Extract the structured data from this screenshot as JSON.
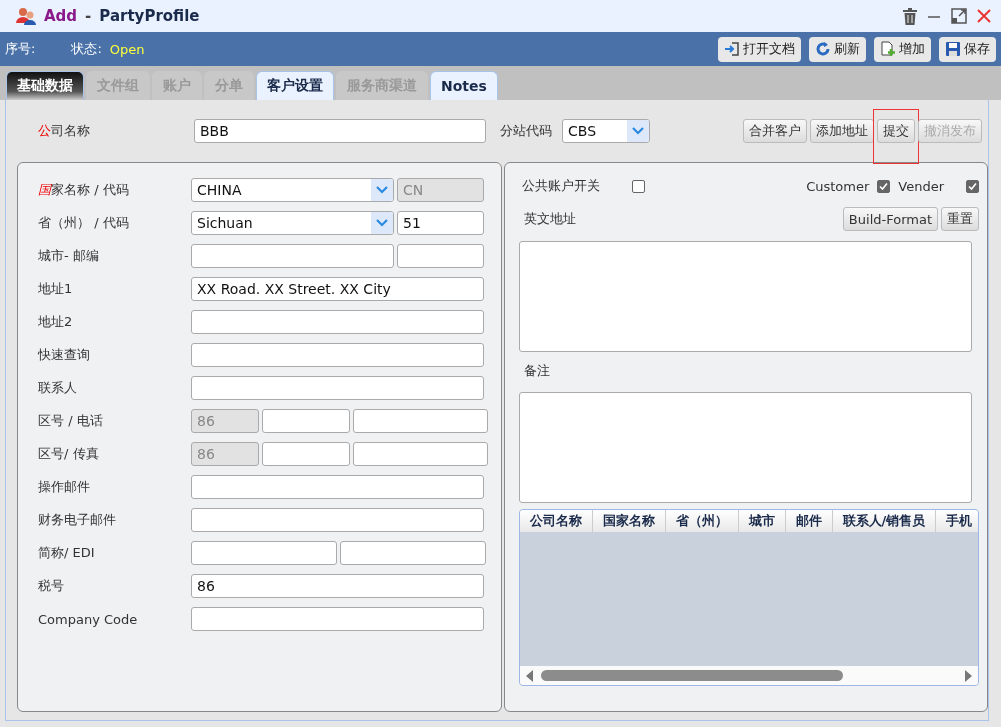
{
  "window": {
    "title_action": "Add",
    "title_separator": "-",
    "title": "PartyProfile"
  },
  "status": {
    "seq_label": "序号:",
    "state_label": "状态:",
    "state_value": "Open"
  },
  "toolbar": [
    {
      "label": "打开文档",
      "kind": "open"
    },
    {
      "label": "刷新",
      "kind": "refresh"
    },
    {
      "label": "增加",
      "kind": "add"
    },
    {
      "label": "保存",
      "kind": "save"
    }
  ],
  "tabs": [
    {
      "label": "基础数据",
      "selected": true,
      "disabled": false
    },
    {
      "label": "文件组",
      "selected": false,
      "disabled": true
    },
    {
      "label": "账户",
      "selected": false,
      "disabled": true
    },
    {
      "label": "分单",
      "selected": false,
      "disabled": true
    },
    {
      "label": "客户设置",
      "selected": false,
      "disabled": false
    },
    {
      "label": "服务商渠道",
      "selected": false,
      "disabled": true
    },
    {
      "label": "Notes",
      "selected": false,
      "disabled": false
    }
  ],
  "company": {
    "mark": "公",
    "label": "司名称",
    "value": "BBB"
  },
  "branch": {
    "label": "分站代码",
    "value": "CBS"
  },
  "actions": [
    {
      "label": "合并客户",
      "disabled": false,
      "highlighted": false
    },
    {
      "label": "添加地址",
      "disabled": false,
      "highlighted": false
    },
    {
      "label": "提交",
      "disabled": false,
      "highlighted": true
    },
    {
      "label": "撤消发布",
      "disabled": true,
      "highlighted": false
    }
  ],
  "address_form": [
    {
      "kind": "select-code",
      "mark": "国",
      "label": "家名称 /  代码",
      "inputs": [
        {
          "value": "CHINA",
          "disabled": false
        },
        {
          "value": "CN",
          "disabled": true
        }
      ]
    },
    {
      "kind": "select-code",
      "label": "省（州） /  代码",
      "inputs": [
        {
          "value": "Sichuan",
          "disabled": false
        },
        {
          "value": "51",
          "disabled": false
        }
      ]
    },
    {
      "kind": "pair",
      "label": "城市- 邮编",
      "inputs": [
        {
          "disabled": false
        },
        {
          "disabled": false
        }
      ]
    },
    {
      "kind": "single",
      "label": "地址1",
      "inputs": [
        {
          "value": "XX Road. XX Street. XX City",
          "disabled": false
        }
      ]
    },
    {
      "kind": "single",
      "label": "地址2",
      "inputs": [
        {
          "disabled": false
        }
      ]
    },
    {
      "kind": "single",
      "label": "快速查询",
      "inputs": [
        {
          "disabled": false
        }
      ]
    },
    {
      "kind": "single",
      "label": "联系人",
      "inputs": [
        {
          "disabled": false
        }
      ]
    },
    {
      "kind": "triple",
      "label": "区号 /  电话",
      "inputs": [
        {
          "value": "86",
          "disabled": true
        },
        {
          "disabled": false
        },
        {
          "disabled": false
        }
      ]
    },
    {
      "kind": "triple",
      "label": "区号/  传真",
      "inputs": [
        {
          "value": "86",
          "disabled": true
        },
        {
          "disabled": false
        },
        {
          "disabled": false
        }
      ]
    },
    {
      "kind": "single",
      "label": "操作邮件",
      "inputs": [
        {
          "disabled": false
        }
      ]
    },
    {
      "kind": "single",
      "label": "财务电子邮件",
      "inputs": [
        {
          "disabled": false
        }
      ]
    },
    {
      "kind": "half",
      "label": "简称/ EDI",
      "inputs": [
        {
          "disabled": false
        },
        {
          "disabled": false
        }
      ]
    },
    {
      "kind": "single",
      "label": "税号",
      "inputs": [
        {
          "value": "86",
          "disabled": false
        }
      ]
    },
    {
      "kind": "single",
      "label": "Company Code",
      "inputs": [
        {
          "disabled": false
        }
      ]
    }
  ],
  "public_account": {
    "label": "公共账户开关",
    "checked": false
  },
  "customer": {
    "label": "Customer",
    "checked": true
  },
  "vender": {
    "label": "Vender",
    "checked": true
  },
  "english_address": {
    "label": "英文地址",
    "buttons": [
      "Build-Format",
      "重置"
    ]
  },
  "remarks": {
    "label": "备注"
  },
  "address_table": {
    "columns": [
      "公司名称",
      "国家名称",
      "省（州）",
      "城市",
      "邮件",
      "联系人/销售员",
      "手机"
    ]
  }
}
